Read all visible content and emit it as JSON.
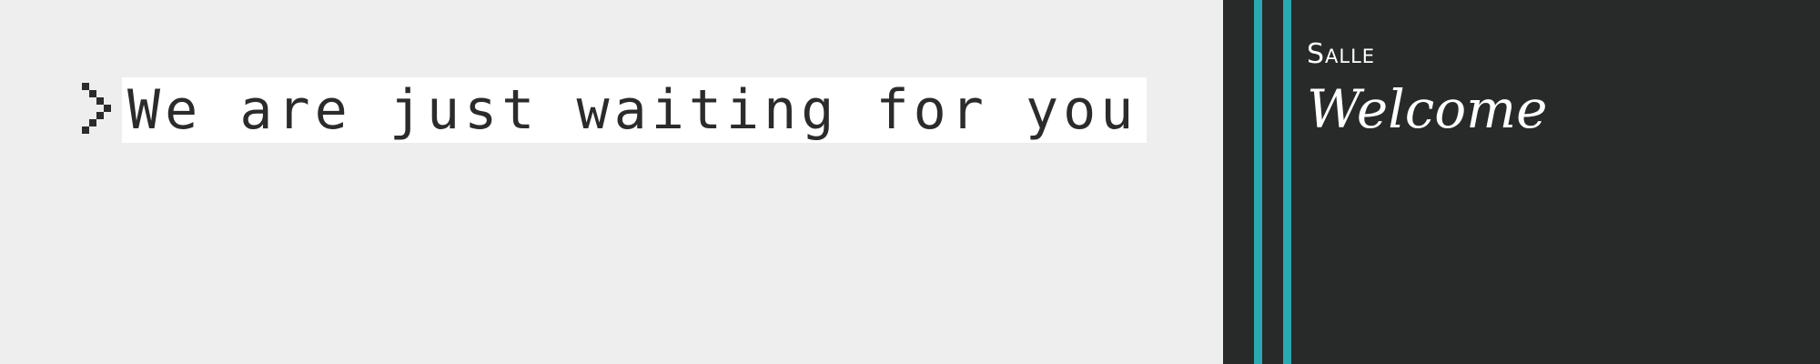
{
  "terminal": {
    "prompt_symbol": ">",
    "message": "We are just waiting for you"
  },
  "panel": {
    "brand": "Salle",
    "greeting": "Welcome"
  },
  "colors": {
    "page_background": "#eeeeee",
    "text_highlight": "#ffffff",
    "text_color": "#2b2b2b",
    "panel_background": "#282a29",
    "accent": "#2aa9b3",
    "panel_text": "#ffffff"
  },
  "icons": {
    "prompt": "chevron-right-icon"
  }
}
